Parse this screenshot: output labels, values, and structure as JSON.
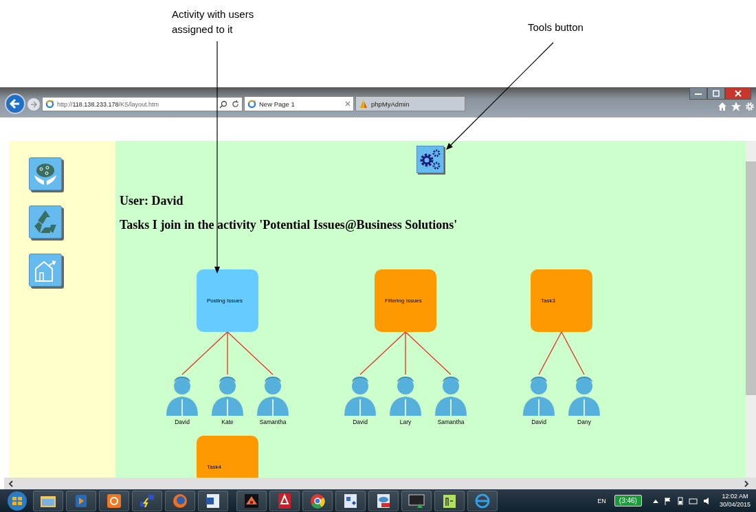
{
  "annotations": [
    {
      "text": "Activity with users\nassigned to it"
    },
    {
      "text": "Tools button"
    }
  ],
  "browser": {
    "address_prefix": "http://",
    "address_host": "118.138.233.178",
    "address_path": "/KS/layout.htm",
    "tabs": [
      {
        "title": "New Page 1",
        "selected": true
      },
      {
        "title": "phpMyAdmin",
        "selected": false
      }
    ]
  },
  "page": {
    "user": "User: David",
    "heading": "Tasks I join in the activity 'Potential Issues@Business Solutions'",
    "tasks": [
      {
        "name": "Posting Issues",
        "color": "#66ccff",
        "users": [
          "David",
          "Kate",
          "Samantha"
        ]
      },
      {
        "name": "Filtering Issues",
        "color": "#ff9900",
        "users": [
          "David",
          "Lary",
          "Samantha"
        ]
      },
      {
        "name": "Task3",
        "color": "#ff9900",
        "users": [
          "David",
          "Dany"
        ]
      },
      {
        "name": "Task4",
        "color": "#ff9900"
      }
    ]
  },
  "taskbar": {
    "language": "EN",
    "battery": "(3:46)",
    "time": "12:02 AM",
    "date": "30/04/2015"
  }
}
